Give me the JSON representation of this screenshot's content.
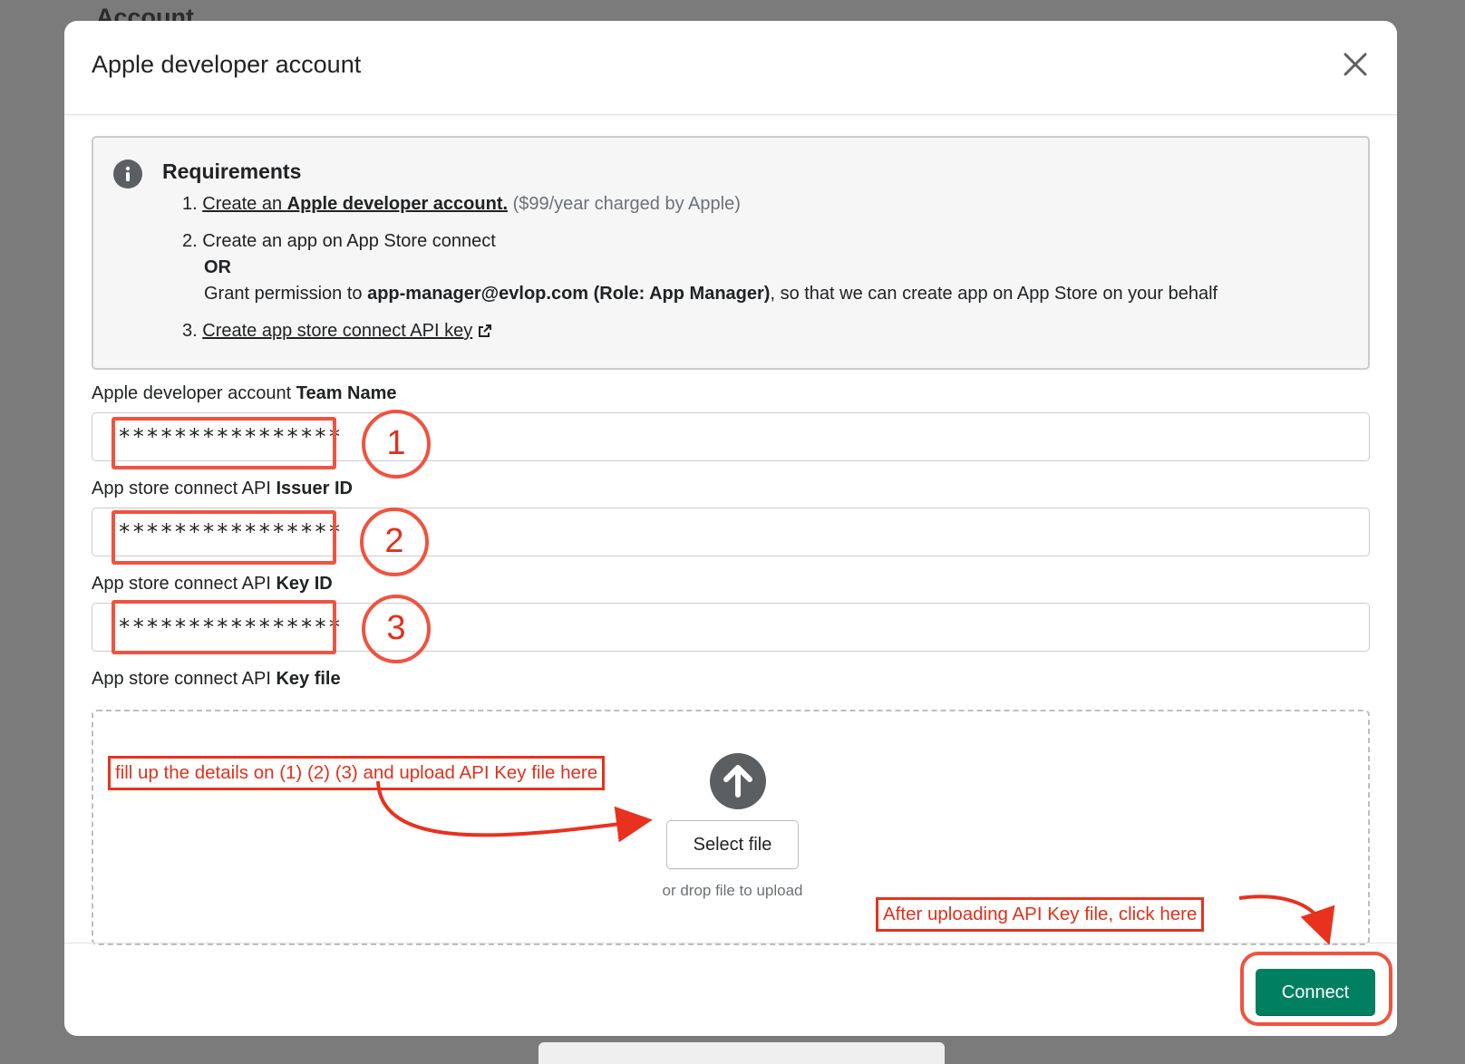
{
  "background": {
    "page_title": "Account"
  },
  "modal": {
    "title": "Apple developer account",
    "requirements": {
      "title": "Requirements",
      "item1": {
        "number": "1.",
        "link_prefix": "Create an ",
        "link_bold": "Apple developer account.",
        "note": " ($99/year charged by Apple)"
      },
      "item2": {
        "number": "2.",
        "line1": "Create an app on App Store connect",
        "or": "OR",
        "grant_prefix": "Grant permission to ",
        "grant_bold": "app-manager@evlop.com (Role: App Manager)",
        "grant_suffix": ", so that we can create app on App Store on your behalf"
      },
      "item3": {
        "number": "3.",
        "link": "Create app store connect API key"
      }
    },
    "fields": {
      "team_name": {
        "label_prefix": "Apple developer account ",
        "label_bold": "Team Name",
        "value": "****************"
      },
      "issuer_id": {
        "label_prefix": "App store connect API ",
        "label_bold": "Issuer ID",
        "value": "****************"
      },
      "key_id": {
        "label_prefix": "App store connect API ",
        "label_bold": "Key ID",
        "value": "****************"
      },
      "key_file": {
        "label_prefix": "App store connect API ",
        "label_bold": "Key file"
      }
    },
    "dropzone": {
      "button_label": "Select file",
      "hint": "or drop file to upload"
    },
    "footer": {
      "connect_label": "Connect"
    }
  },
  "annotations": {
    "circle1": "1",
    "circle2": "2",
    "circle3": "3",
    "fill_note": "fill up the details on (1) (2) (3) and upload API Key file here",
    "connect_note": "After uploading API Key file, click here",
    "color": "#f0533f"
  },
  "icons": {
    "close": "close-icon",
    "info": "info-icon",
    "external_link": "external-link-icon",
    "upload": "upload-arrow-icon"
  },
  "colors": {
    "primary": "#008060",
    "overlay": "#7b7b7b"
  }
}
